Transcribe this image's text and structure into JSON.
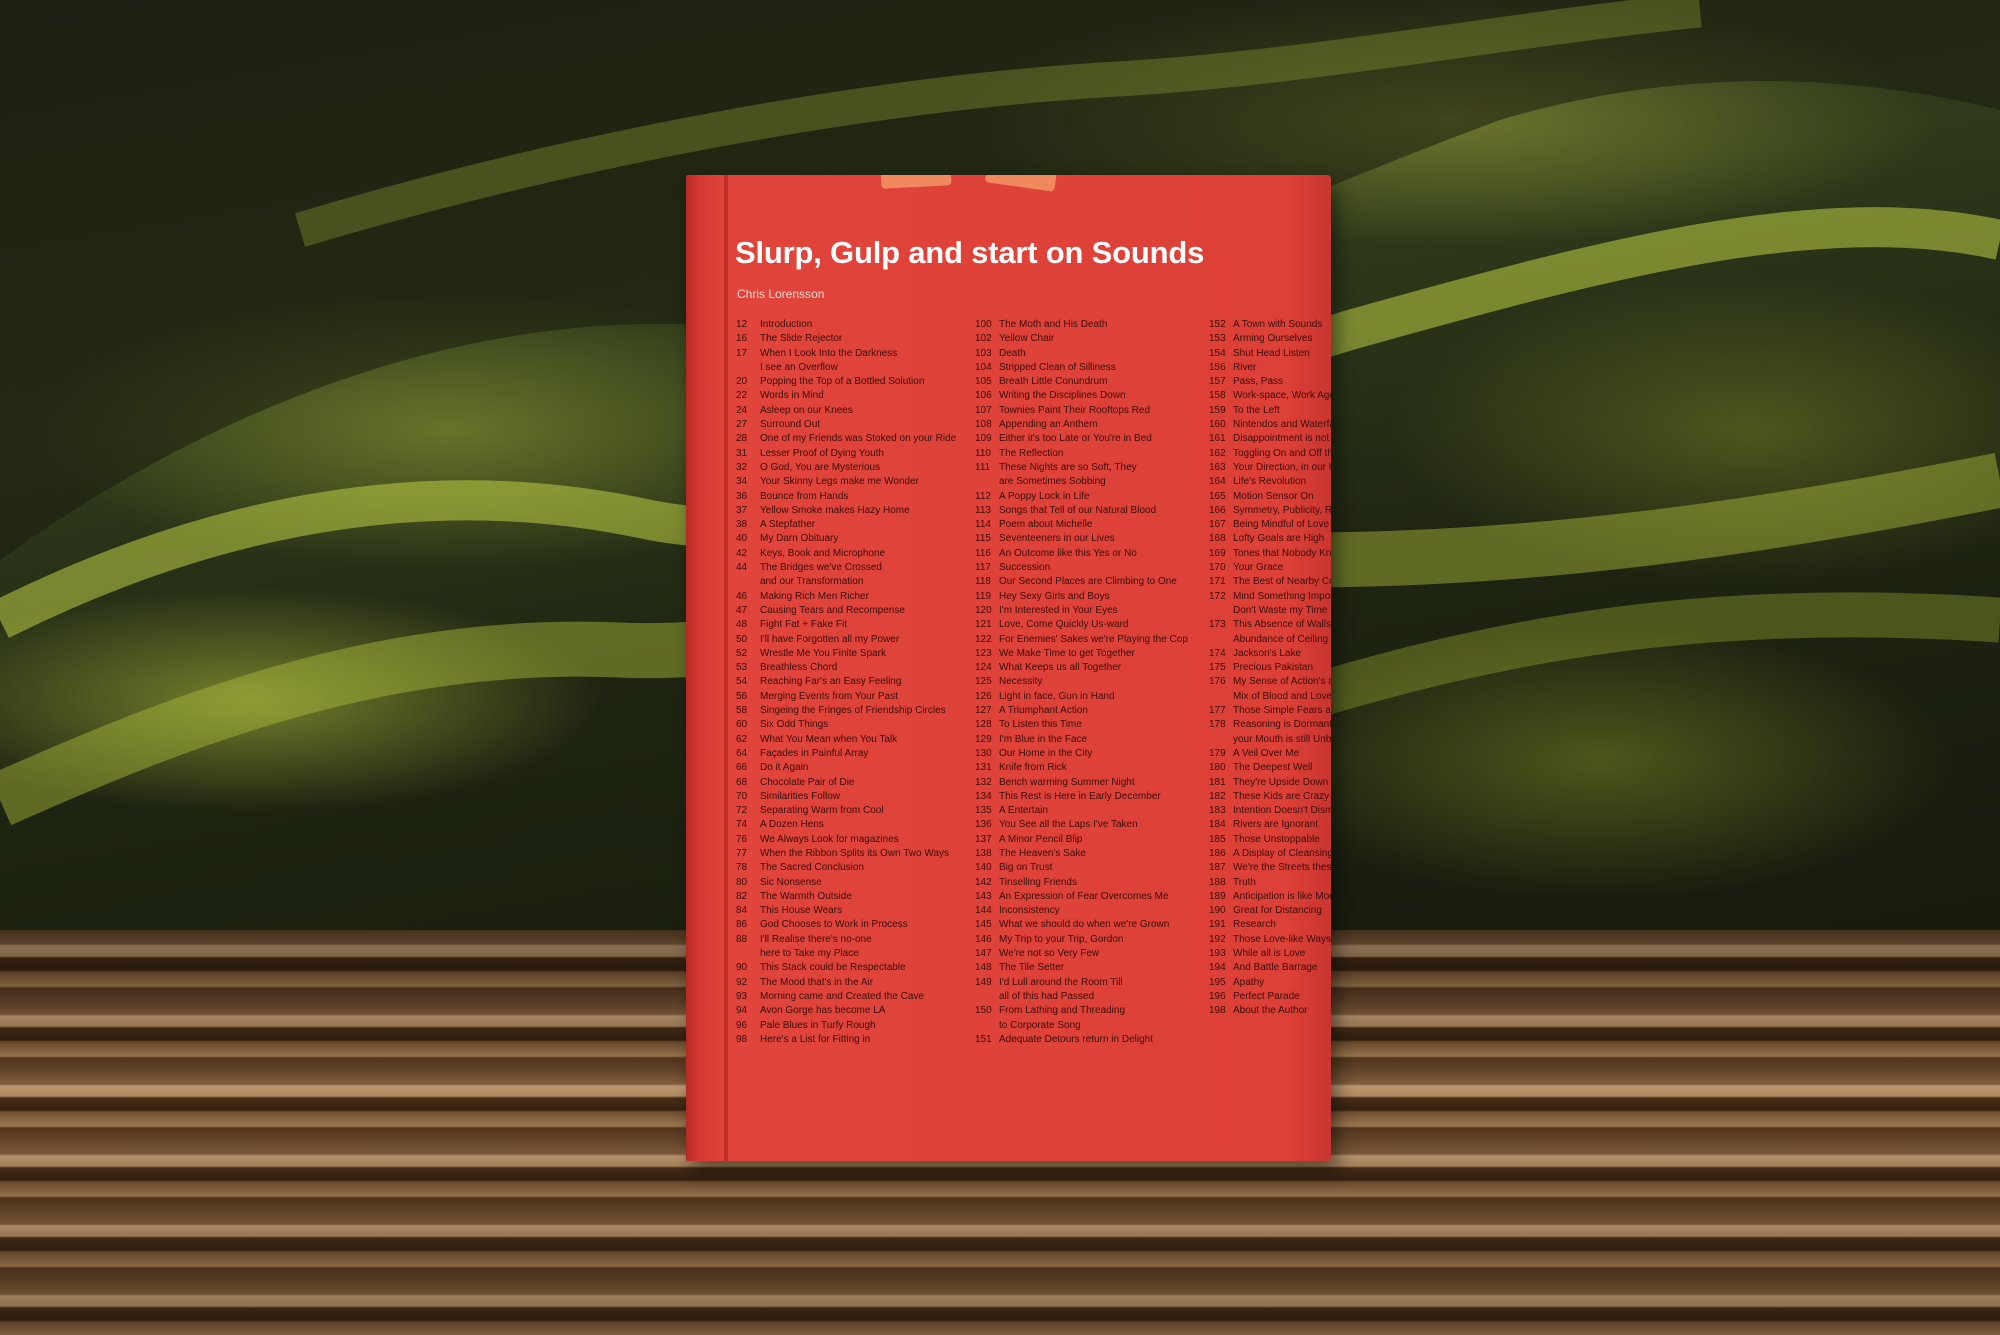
{
  "book": {
    "title": "Slurp, Gulp and start on Sounds",
    "author": "Chris Lorensson",
    "cover_color": "#dd4036",
    "columns": [
      [
        {
          "n": "12",
          "t": "Introduction"
        },
        {
          "n": "16",
          "t": "The Slide Rejector"
        },
        {
          "n": "17",
          "t": "When I Look Into the Darkness"
        },
        {
          "n": "",
          "t": "I see an Overflow"
        },
        {
          "n": "20",
          "t": "Popping the Top of a Bottled Solution"
        },
        {
          "n": "22",
          "t": "Words in Mind"
        },
        {
          "n": "24",
          "t": "Asleep on our Knees"
        },
        {
          "n": "27",
          "t": "Surround Out"
        },
        {
          "n": "28",
          "t": "One of my Friends was Stoked on your Ride"
        },
        {
          "n": "31",
          "t": "Lesser Proof of Dying Youth"
        },
        {
          "n": "32",
          "t": "O God, You are Mysterious"
        },
        {
          "n": "34",
          "t": "Your Skinny Legs make me Wonder"
        },
        {
          "n": "36",
          "t": "Bounce from Hands"
        },
        {
          "n": "37",
          "t": "Yellow Smoke makes Hazy Home"
        },
        {
          "n": "38",
          "t": "A Stepfather"
        },
        {
          "n": "40",
          "t": "My Darn Obituary"
        },
        {
          "n": "42",
          "t": "Keys, Book and Microphone"
        },
        {
          "n": "44",
          "t": "The Bridges we've Crossed"
        },
        {
          "n": "",
          "t": "and our Transformation"
        },
        {
          "n": "46",
          "t": "Making Rich Men Richer"
        },
        {
          "n": "47",
          "t": "Causing Tears and Recompense"
        },
        {
          "n": "48",
          "t": "Fight Fat + Fake Fit"
        },
        {
          "n": "50",
          "t": "I'll have Forgotten all my Power"
        },
        {
          "n": "52",
          "t": "Wrestle Me You Finite Spark"
        },
        {
          "n": "53",
          "t": "Breathless Chord"
        },
        {
          "n": "54",
          "t": "Reaching Far's an Easy Feeling"
        },
        {
          "n": "56",
          "t": "Merging Events from Your Past"
        },
        {
          "n": "58",
          "t": "Singeing the Fringes of Friendship Circles"
        },
        {
          "n": "60",
          "t": "Six Odd Things"
        },
        {
          "n": "62",
          "t": "What You Mean when You Talk"
        },
        {
          "n": "64",
          "t": "Façades in Painful Array"
        },
        {
          "n": "66",
          "t": "Do it Again"
        },
        {
          "n": "68",
          "t": "Chocolate Pair of Die"
        },
        {
          "n": "70",
          "t": "Similarities Follow"
        },
        {
          "n": "72",
          "t": "Separating Warm from Cool"
        },
        {
          "n": "74",
          "t": "A Dozen Hens"
        },
        {
          "n": "76",
          "t": "We Always Look for magazines"
        },
        {
          "n": "77",
          "t": "When the Ribbon Splits its Own Two Ways"
        },
        {
          "n": "78",
          "t": "The Sacred Conclusion"
        },
        {
          "n": "80",
          "t": "Sic Nonsense"
        },
        {
          "n": "82",
          "t": "The Warmth Outside"
        },
        {
          "n": "84",
          "t": "This House Wears"
        },
        {
          "n": "86",
          "t": "God Chooses to Work in Process"
        },
        {
          "n": "88",
          "t": "I'll Realise there's no-one"
        },
        {
          "n": "",
          "t": "here to Take my Place"
        },
        {
          "n": "90",
          "t": "This Stack could be Respectable"
        },
        {
          "n": "92",
          "t": "The Mood that's in the Air"
        },
        {
          "n": "93",
          "t": "Morning came and Created the Cave"
        },
        {
          "n": "94",
          "t": "Avon Gorge has become LA"
        },
        {
          "n": "96",
          "t": "Pale Blues in Turfy Rough"
        },
        {
          "n": "98",
          "t": "Here's a List for Fitting in"
        }
      ],
      [
        {
          "n": "100",
          "t": "The Moth and His Death"
        },
        {
          "n": "102",
          "t": "Yellow Chair"
        },
        {
          "n": "103",
          "t": "Death"
        },
        {
          "n": "104",
          "t": "Stripped Clean of Silliness"
        },
        {
          "n": "105",
          "t": "Breath Little Conundrum"
        },
        {
          "n": "106",
          "t": "Writing the Disciplines Down"
        },
        {
          "n": "107",
          "t": "Townies Paint Their Rooftops Red"
        },
        {
          "n": "108",
          "t": "Appending an Anthem"
        },
        {
          "n": "109",
          "t": "Either it's too Late or You're in Bed"
        },
        {
          "n": "110",
          "t": "The Reflection"
        },
        {
          "n": "111",
          "t": "These Nights are so Soft, They"
        },
        {
          "n": "",
          "t": "are Sometimes Sobbing"
        },
        {
          "n": "112",
          "t": "A Poppy Lock in Life"
        },
        {
          "n": "113",
          "t": "Songs that Tell of our Natural Blood"
        },
        {
          "n": "114",
          "t": "Poem about Michelle"
        },
        {
          "n": "115",
          "t": "Seventeeners in our Lives"
        },
        {
          "n": "116",
          "t": "An Outcome like this Yes or No"
        },
        {
          "n": "117",
          "t": "Succession"
        },
        {
          "n": "118",
          "t": "Our Second Places are Climbing to One"
        },
        {
          "n": "119",
          "t": "Hey Sexy Girls and Boys"
        },
        {
          "n": "120",
          "t": "I'm Interested in Your Eyes"
        },
        {
          "n": "121",
          "t": "Love, Come Quickly Us-ward"
        },
        {
          "n": "122",
          "t": "For Enemies' Sakes we're Playing the Cop"
        },
        {
          "n": "123",
          "t": "We Make Time to get Together"
        },
        {
          "n": "124",
          "t": "What Keeps us all Together"
        },
        {
          "n": "125",
          "t": "Necessity"
        },
        {
          "n": "126",
          "t": "Light in face, Gun in Hand"
        },
        {
          "n": "127",
          "t": "A Triumphant Action"
        },
        {
          "n": "128",
          "t": "To Listen this Time"
        },
        {
          "n": "129",
          "t": "I'm Blue in the Face"
        },
        {
          "n": "130",
          "t": "Our Home in the City"
        },
        {
          "n": "131",
          "t": "Knife from Rick"
        },
        {
          "n": "132",
          "t": "Bench warming Summer Night"
        },
        {
          "n": "134",
          "t": "This Rest is Here in Early December"
        },
        {
          "n": "135",
          "t": "A Entertain"
        },
        {
          "n": "136",
          "t": "You See all the Laps I've Taken"
        },
        {
          "n": "137",
          "t": "A Minor Pencil Blip"
        },
        {
          "n": "138",
          "t": "The Heaven's Sake"
        },
        {
          "n": "140",
          "t": "Big on Trust"
        },
        {
          "n": "142",
          "t": "Tinselling Friends"
        },
        {
          "n": "143",
          "t": "An Expression of Fear Overcomes Me"
        },
        {
          "n": "144",
          "t": "Inconsistency"
        },
        {
          "n": "145",
          "t": "What we should do when we're Grown"
        },
        {
          "n": "146",
          "t": "My Trip to your Trip, Gordon"
        },
        {
          "n": "147",
          "t": "We're not so Very Few"
        },
        {
          "n": "148",
          "t": "The Tile Setter"
        },
        {
          "n": "149",
          "t": "I'd Lull around the Room Till"
        },
        {
          "n": "",
          "t": "all of this had Passed"
        },
        {
          "n": "150",
          "t": "From Lathing and Threading"
        },
        {
          "n": "",
          "t": "to Corporate Song"
        },
        {
          "n": "151",
          "t": "Adequate Detours return in Delight"
        }
      ],
      [
        {
          "n": "152",
          "t": "A Town with Sounds"
        },
        {
          "n": "153",
          "t": "Arming Ourselves"
        },
        {
          "n": "154",
          "t": "Shut Head Listen"
        },
        {
          "n": "156",
          "t": "River"
        },
        {
          "n": "157",
          "t": "Pass, Pass"
        },
        {
          "n": "158",
          "t": "Work-space, Work Age"
        },
        {
          "n": "159",
          "t": "To the Left"
        },
        {
          "n": "160",
          "t": "Nintendos and Waterfalls"
        },
        {
          "n": "161",
          "t": "Disappointment is not on"
        },
        {
          "n": "162",
          "t": "Toggling On and Off the"
        },
        {
          "n": "163",
          "t": "Your Direction, in our Ha"
        },
        {
          "n": "164",
          "t": "Life's Revolution"
        },
        {
          "n": "165",
          "t": "Motion Sensor On"
        },
        {
          "n": "166",
          "t": "Symmetry, Publicity, Ro"
        },
        {
          "n": "167",
          "t": "Being Mindful of Love"
        },
        {
          "n": "168",
          "t": "Lofty Goals are High"
        },
        {
          "n": "169",
          "t": "Tones that Nobody Kno"
        },
        {
          "n": "170",
          "t": "Your Grace"
        },
        {
          "n": "171",
          "t": "The Best of Nearby Co"
        },
        {
          "n": "172",
          "t": "Mind Something Import"
        },
        {
          "n": "",
          "t": "Don't Waste my Time"
        },
        {
          "n": "173",
          "t": "This Absence of Walls a"
        },
        {
          "n": "",
          "t": "Abundance of Ceiling"
        },
        {
          "n": "174",
          "t": "Jackson's Lake"
        },
        {
          "n": "175",
          "t": "Precious Pakistan"
        },
        {
          "n": "176",
          "t": "My Sense of Action's a"
        },
        {
          "n": "",
          "t": "Mix of Blood and Love"
        },
        {
          "n": "177",
          "t": "Those Simple Fears all"
        },
        {
          "n": "178",
          "t": "Reasoning is Dormant"
        },
        {
          "n": "",
          "t": "your Mouth is still Unbo"
        },
        {
          "n": "179",
          "t": "A Veil Over Me"
        },
        {
          "n": "180",
          "t": "The Deepest Well"
        },
        {
          "n": "181",
          "t": "They're Upside Down"
        },
        {
          "n": "182",
          "t": "These Kids are Crazy"
        },
        {
          "n": "183",
          "t": "Intention Doesn't Dism"
        },
        {
          "n": "184",
          "t": "Rivers are Ignorant"
        },
        {
          "n": "185",
          "t": "Those Unstoppable"
        },
        {
          "n": "186",
          "t": "A Display of Cleansing"
        },
        {
          "n": "187",
          "t": "We're the Streets these"
        },
        {
          "n": "188",
          "t": "Truth"
        },
        {
          "n": "189",
          "t": "Anticipation is like Mod"
        },
        {
          "n": "190",
          "t": "Great for Distancing"
        },
        {
          "n": "191",
          "t": "Research"
        },
        {
          "n": "192",
          "t": "Those Love-like Ways"
        },
        {
          "n": "193",
          "t": "While all is Love"
        },
        {
          "n": "194",
          "t": "And Battle Barrage"
        },
        {
          "n": "195",
          "t": "Apathy"
        },
        {
          "n": "196",
          "t": "Perfect Parade"
        },
        {
          "n": "198",
          "t": "About the Author"
        }
      ]
    ]
  }
}
